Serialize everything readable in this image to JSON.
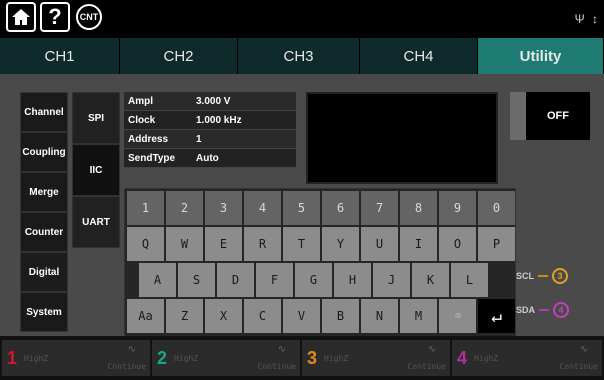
{
  "topbar": {
    "home_icon": "home-icon",
    "help_label": "?",
    "counter_label": "CNT",
    "usb_label": "Ψ ↕"
  },
  "tabs": [
    {
      "label": "CH1"
    },
    {
      "label": "CH2"
    },
    {
      "label": "CH3"
    },
    {
      "label": "CH4"
    },
    {
      "label": "Utility"
    }
  ],
  "left_menu": [
    {
      "label": "Channel"
    },
    {
      "label": "Coupling"
    },
    {
      "label": "Merge"
    },
    {
      "label": "Counter"
    },
    {
      "label": "Digital"
    },
    {
      "label": "System"
    }
  ],
  "sub_menu": [
    {
      "label": "SPI"
    },
    {
      "label": "IIC"
    },
    {
      "label": "UART"
    }
  ],
  "params": [
    {
      "label": "Ampl",
      "value": "3.000 V"
    },
    {
      "label": "Clock",
      "value": "1.000 kHz"
    },
    {
      "label": "Address",
      "value": "1"
    },
    {
      "label": "SendType",
      "value": "Auto"
    }
  ],
  "output_toggle": {
    "label": "OFF"
  },
  "pins": {
    "scl": {
      "label": "SCL",
      "num": "3",
      "color": "#e0a020"
    },
    "sda": {
      "label": "SDA",
      "num": "4",
      "color": "#c040c0"
    }
  },
  "keyboard": {
    "row1": [
      "1",
      "2",
      "3",
      "4",
      "5",
      "6",
      "7",
      "8",
      "9",
      "0"
    ],
    "row2": [
      "Q",
      "W",
      "E",
      "R",
      "T",
      "Y",
      "U",
      "I",
      "O",
      "P"
    ],
    "row3": [
      "A",
      "S",
      "D",
      "F",
      "G",
      "H",
      "J",
      "K",
      "L"
    ],
    "row4": [
      "Aa",
      "Z",
      "X",
      "C",
      "V",
      "B",
      "N",
      "M"
    ],
    "backspace": "⌫",
    "enter": "↵"
  },
  "channels": [
    {
      "num": "1",
      "impedance": "HighZ",
      "mode": "Continue",
      "color": "#d11a2a"
    },
    {
      "num": "2",
      "impedance": "HighZ",
      "mode": "Continue",
      "color": "#1aa58f"
    },
    {
      "num": "3",
      "impedance": "HighZ",
      "mode": "Continue",
      "color": "#e08a1a"
    },
    {
      "num": "4",
      "impedance": "HighZ",
      "mode": "Continue",
      "color": "#b0309f"
    }
  ]
}
